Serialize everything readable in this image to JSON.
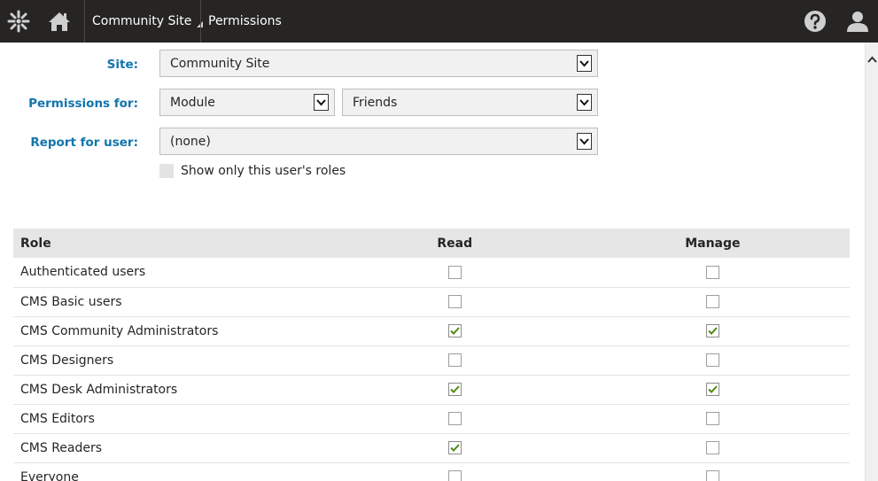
{
  "topbar": {
    "site_name": "Community Site",
    "current_app": "Permissions",
    "icons": [
      "logo-icon",
      "home-icon",
      "help-icon",
      "user-icon"
    ]
  },
  "form": {
    "site_label": "Site:",
    "site_value": "Community Site",
    "permissions_for_label": "Permissions for:",
    "permissions_type_value": "Module",
    "permissions_module_value": "Friends",
    "report_label": "Report for user:",
    "report_value": "(none)",
    "show_only_label": "Show only this user's roles"
  },
  "table": {
    "headers": [
      "Role",
      "Read",
      "Manage"
    ],
    "rows": [
      {
        "role": "Authenticated users",
        "read": false,
        "manage": false
      },
      {
        "role": "CMS Basic users",
        "read": false,
        "manage": false
      },
      {
        "role": "CMS Community Administrators",
        "read": true,
        "manage": true
      },
      {
        "role": "CMS Designers",
        "read": false,
        "manage": false
      },
      {
        "role": "CMS Desk Administrators",
        "read": true,
        "manage": true
      },
      {
        "role": "CMS Editors",
        "read": false,
        "manage": false
      },
      {
        "role": "CMS Readers",
        "read": true,
        "manage": false
      },
      {
        "role": "Everyone",
        "read": false,
        "manage": false
      }
    ]
  },
  "colors": {
    "topbar_bg": "#262524",
    "label_blue": "#1175ae",
    "check_green": "#4f8a10"
  }
}
